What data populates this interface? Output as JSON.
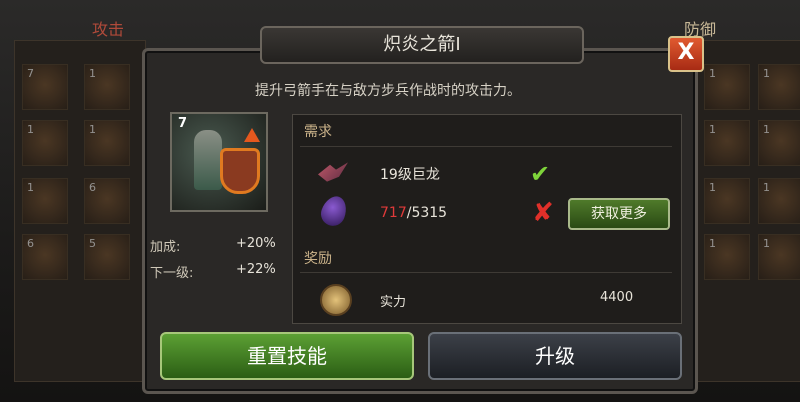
{
  "background": {
    "left_panel_title": "攻击",
    "right_panel_title": "防御",
    "left_tiles": [
      "7",
      "1",
      "1",
      "1",
      "1",
      "6",
      "6",
      "5"
    ],
    "right_tiles": [
      "1",
      "1",
      "1",
      "1",
      "1",
      "1",
      "1",
      "1"
    ]
  },
  "dialog": {
    "title": "炽炎之箭I",
    "close_label": "X",
    "description": "提升弓箭手在与敌方步兵作战时的攻击力。",
    "unit_level": "7",
    "stats": [
      {
        "label": "加成:",
        "value": "+20%"
      },
      {
        "label": "下一级:",
        "value": "+22%"
      }
    ],
    "requirements": {
      "header": "需求",
      "items": [
        {
          "icon": "dragon-icon",
          "text": "19级巨龙",
          "status": "met"
        },
        {
          "icon": "gem-icon",
          "current": "717",
          "required": "/5315",
          "status": "not-met"
        }
      ],
      "get_more_label": "获取更多"
    },
    "rewards": {
      "header": "奖励",
      "items": [
        {
          "icon": "medal-icon",
          "label": "实力",
          "value": "4400"
        }
      ]
    },
    "buttons": {
      "reset_label": "重置技能",
      "upgrade_label": "升级"
    }
  },
  "colors": {
    "accent_green": "#5ca034",
    "accent_red": "#e03a3a",
    "check_green": "#7ed43a",
    "close_orange": "#e15a30"
  }
}
